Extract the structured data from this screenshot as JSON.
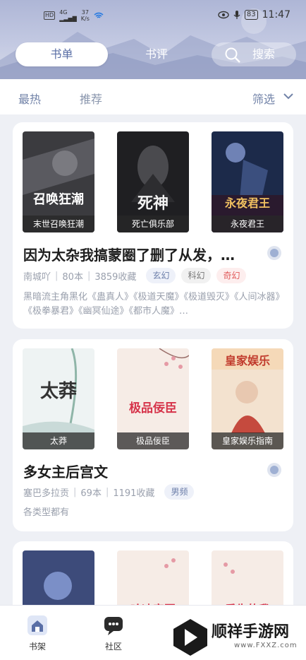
{
  "status_bar": {
    "network_badge": "HD",
    "signal": "4G",
    "speed_value": "37",
    "speed_unit": "K/s",
    "battery": "83",
    "time": "11:47"
  },
  "tabs": {
    "active": "书单",
    "second": "书评",
    "search": "搜索"
  },
  "filters": {
    "hot": "最热",
    "recommend": "推荐",
    "filter": "筛选"
  },
  "lists": [
    {
      "covers": [
        {
          "caption": "末世召唤狂潮",
          "art_text": "召唤狂潮"
        },
        {
          "caption": "死亡俱乐部",
          "art_text": "死神"
        },
        {
          "caption": "永夜君王",
          "art_text": "永夜君王"
        }
      ],
      "title": "因为太杂我搞蒙圈了删了从发，…",
      "author": "南城吖",
      "count": "80本",
      "favorites": "3859收藏",
      "tags": [
        "玄幻",
        "科幻",
        "奇幻"
      ],
      "desc": "黑暗流主角黑化《蛊真人》《极道天魔》《极道毁灭》《人间冰器》《极拳暴君》《幽冥仙途》《都市人魔》…"
    },
    {
      "covers": [
        {
          "caption": "太莽",
          "art_text": "太莽"
        },
        {
          "caption": "极品佞臣",
          "art_text": "极品佞臣"
        },
        {
          "caption": "皇家娱乐指南",
          "art_text": "皇家娱乐"
        }
      ],
      "title": "多女主后宫文",
      "author": "塞巴多拉贡",
      "count": "69本",
      "favorites": "1191收藏",
      "tags": [
        "男频"
      ],
      "desc": "各类型都有"
    },
    {
      "covers": [
        {
          "caption": "",
          "art_text": ""
        },
        {
          "caption": "",
          "art_text": "哈迪帝国"
        },
        {
          "caption": "",
          "art_text": "重生的我"
        }
      ]
    }
  ],
  "bottom_nav": {
    "bookshelf": "书架",
    "community": "社区"
  },
  "watermark": {
    "name": "顺祥手游网",
    "url": "www.FXXZ.com"
  },
  "colors": {
    "accent": "#5a6fa6",
    "tag_pink": "#e05a5a"
  }
}
